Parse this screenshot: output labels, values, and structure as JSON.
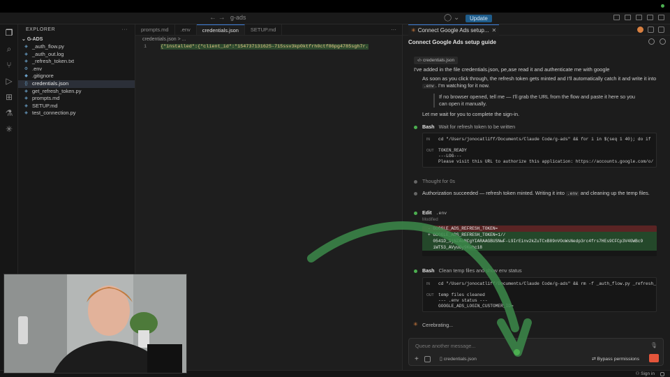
{
  "app": {
    "search_text": "g-ads",
    "update_label": "Update"
  },
  "explorer": {
    "header": "EXPLORER",
    "more": "···",
    "folder": "G-ADS",
    "files": [
      {
        "name": "_auth_flow.py",
        "icon": "python-file-icon"
      },
      {
        "name": "_auth_out.log",
        "icon": "log-file-icon"
      },
      {
        "name": "_refresh_token.txt",
        "icon": "text-file-icon"
      },
      {
        "name": ".env",
        "icon": "gear-icon"
      },
      {
        "name": ".gitignore",
        "icon": "git-icon"
      },
      {
        "name": "credentials.json",
        "icon": "json-file-icon",
        "selected": true
      },
      {
        "name": "get_refresh_token.py",
        "icon": "python-file-icon"
      },
      {
        "name": "prompts.md",
        "icon": "markdown-file-icon"
      },
      {
        "name": "SETUP.md",
        "icon": "markdown-file-icon"
      },
      {
        "name": "test_connection.py",
        "icon": "python-file-icon"
      }
    ]
  },
  "editor": {
    "tabs": [
      {
        "label": "prompts.md",
        "active": false
      },
      {
        "label": ".env",
        "active": false
      },
      {
        "label": "credentials.json",
        "active": true
      },
      {
        "label": "SETUP.md",
        "active": false
      }
    ],
    "breadcrumb": "credentials.json > ...",
    "line_number": "1",
    "line_code": "{\"installed\":{\"client_id\":\"154737131625-715ssv3kp0ktfrh0ctf86pg4785sgh7r."
  },
  "chat": {
    "tab_title": "Connect Google Ads setup...",
    "header_title": "Connect Google Ads setup guide",
    "attached_file": "credentials.json",
    "user_message": "I've added in the file credentials.json, pe,ase read it and authenticate me with google",
    "para1_a": "As soon as you click through, the refresh token gets minted and I'll automatically catch it and write it into",
    "para1_code": ".env",
    "para1_b": ". I'm watching for it now.",
    "quote": "If no browser opened, tell me — I'll grab the URL from the flow and paste it here so you can open it manually.",
    "para2": "Let me wait for you to complete the sign-in.",
    "bash1_label": "Bash",
    "bash1_desc": "Wait for refresh token to be written",
    "bash1_in_label": "IN",
    "bash1_in": "cd \"/Users/jonocatliff/Documents/Claude Code/g-ads\" && for i in $(seq 1 40); do if",
    "bash1_out_label": "OUT",
    "bash1_out1": "TOKEN_READY",
    "bash1_out2": "---LOG---",
    "bash1_out3": "Please visit this URL to authorize this application: https://accounts.google.com/o/",
    "thought": "Thought for 0s",
    "success_a": "Authorization succeeded — refresh token minted. Writing it into",
    "success_code": ".env",
    "success_b": "and cleaning up the temp files.",
    "edit_label": "Edit",
    "edit_file": ".env",
    "edit_status": "Modified",
    "diff_del": "- GOOGLE_ADS_REFRESH_TOKEN=",
    "diff_add1": "+ GOOGLE_ADS_REFRESH_TOKEN=1//",
    "diff_add2": "  0541D_SjNZAoNCgYIARAAGBUSNwF-L9IrEinv2kZuTCxB89nVOoWsNedp3rc4frs7HEs9CFCp3V4GWBc9",
    "diff_add3": "  iWT53_AVyuGy9Kwhc18",
    "bash2_label": "Bash",
    "bash2_desc": "Clean temp files and show env status",
    "bash2_in_label": "IN",
    "bash2_in": "cd \"/Users/jonocatliff/Documents/Claude Code/g-ads\" && rm -f _auth_flow.py _refresh_",
    "bash2_out_label": "OUT",
    "bash2_out1": "temp files cleaned",
    "bash2_out2": "--- .env status ---",
    "bash2_out3": "GOOGLE_ADS_LOGIN_CUSTOMER_ID=",
    "status": "Cerebrating...",
    "composer_placeholder": "Queue another message...",
    "composer_file": "credentials.json",
    "bypass": "Bypass permissions"
  },
  "statusbar": {
    "sign_in": "Sign in"
  },
  "colors": {
    "accent_blue": "#3a7bd5",
    "success_green": "#4caf50",
    "claude_orange": "#d98040",
    "send_red": "#e4553b"
  }
}
